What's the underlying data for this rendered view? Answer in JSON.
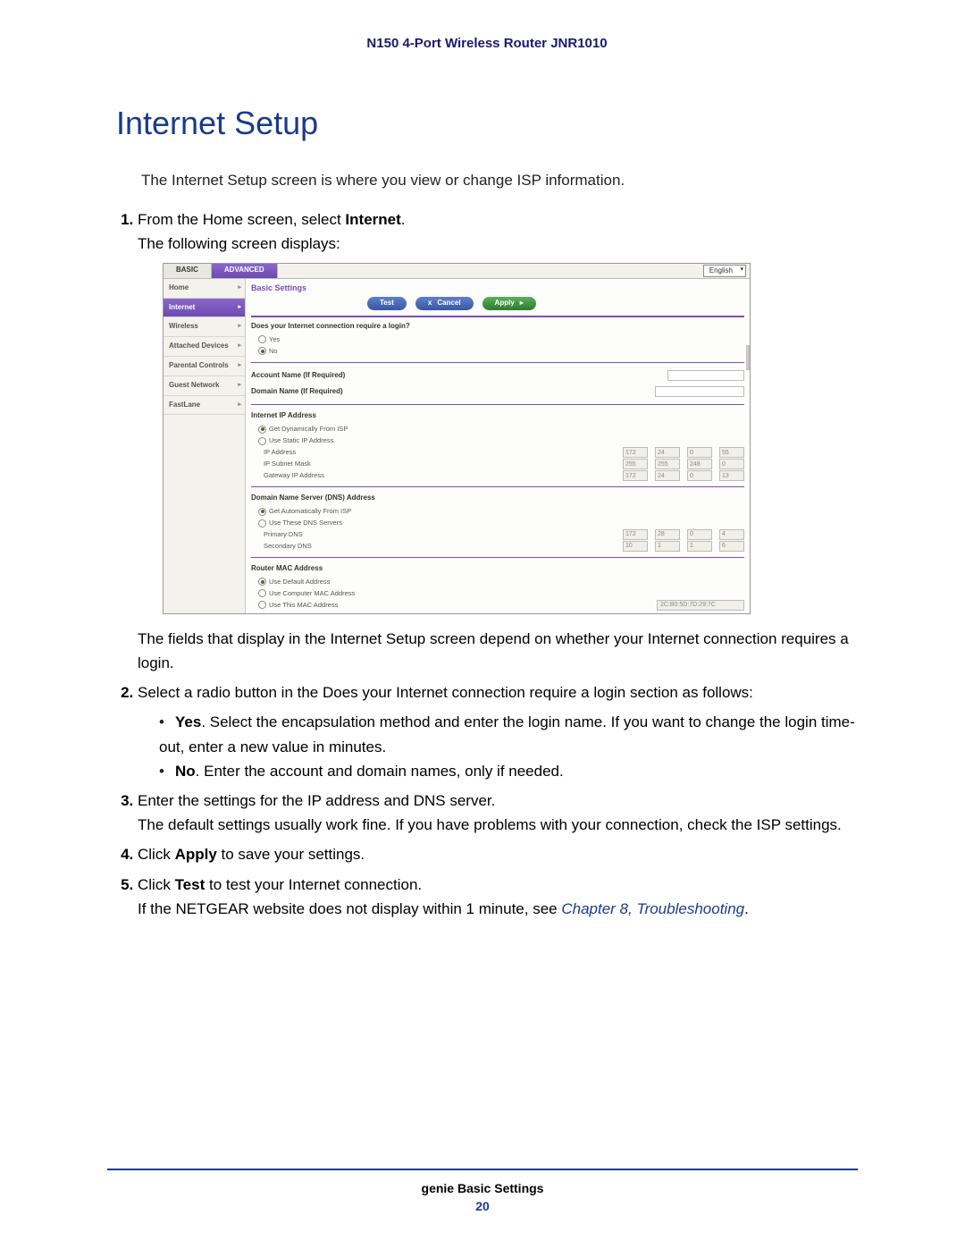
{
  "header": {
    "title": "N150 4-Port Wireless Router JNR1010"
  },
  "section": {
    "heading": "Internet Setup"
  },
  "paragraphs": {
    "intro": "The Internet Setup screen is where you view or change ISP information.",
    "after_shot": "The fields that display in the Internet Setup screen depend on whether your Internet connection requires a login."
  },
  "steps": {
    "s1_a": "From the Home screen, select ",
    "s1_b": "Internet",
    "s1_c": ".",
    "s1_follow": "The following screen displays:",
    "s2": "Select a radio button in the Does your Internet connection require a login section as follows:",
    "s2_yes_b": "Yes",
    "s2_yes": ". Select the encapsulation method and enter the login name. If you want to change the login time-out, enter a new value in minutes.",
    "s2_no_b": "No",
    "s2_no": ". Enter the account and domain names, only if needed.",
    "s3": "Enter the settings for the IP address and DNS server.",
    "s3_follow": "The default settings usually work fine. If you have problems with your connection, check the ISP settings.",
    "s4_a": "Click ",
    "s4_b": "Apply",
    "s4_c": " to save your settings.",
    "s5_a": "Click ",
    "s5_b": "Test",
    "s5_c": " to test your Internet connection.",
    "s5_follow_a": "If the NETGEAR website does not display within 1 minute, see ",
    "s5_follow_link": "Chapter 8, Troubleshooting",
    "s5_follow_c": "."
  },
  "screenshot": {
    "tabs": {
      "basic": "BASIC",
      "advanced": "ADVANCED"
    },
    "language": "English",
    "sidebar": {
      "home": "Home",
      "internet": "Internet",
      "wireless": "Wireless",
      "attached": "Attached Devices",
      "parental": "Parental Controls",
      "guest": "Guest Network",
      "fastlane": "FastLane"
    },
    "title": "Basic Settings",
    "buttons": {
      "test": "Test",
      "cancel": "Cancel",
      "apply": "Apply",
      "x": "x",
      "arrow": "▸"
    },
    "q_login": "Does your Internet connection require a login?",
    "yes": "Yes",
    "no": "No",
    "account_label": "Account Name (If Required)",
    "domain_label": "Domain Name (If Required)",
    "ip_section": "Internet IP Address",
    "ip_opt1": "Get Dynamically From ISP",
    "ip_opt2": "Use Static IP Address",
    "ip_addr_label": "IP Address",
    "ip_addr": {
      "a": "172",
      "b": "24",
      "c": "0",
      "d": "55"
    },
    "subnet_label": "IP Subnet Mask",
    "subnet": {
      "a": "255",
      "b": "255",
      "c": "248",
      "d": "0"
    },
    "gateway_label": "Gateway IP Address",
    "gateway": {
      "a": "172",
      "b": "24",
      "c": "0",
      "d": "13"
    },
    "dns_section": "Domain Name Server (DNS) Address",
    "dns_opt1": "Get Automatically From ISP",
    "dns_opt2": "Use These DNS Servers",
    "pdns_label": "Primary DNS",
    "pdns": {
      "a": "172",
      "b": "28",
      "c": "0",
      "d": "4"
    },
    "sdns_label": "Secondary DNS",
    "sdns": {
      "a": "10",
      "b": "1",
      "c": "1",
      "d": "6"
    },
    "mac_section": "Router MAC Address",
    "mac_opt1": "Use Default Address",
    "mac_opt2": "Use Computer MAC Address",
    "mac_opt3": "Use This MAC Address",
    "mac_value": "2C:B0:5D:7D:29:7C"
  },
  "footer": {
    "title": "genie Basic Settings",
    "page": "20"
  }
}
